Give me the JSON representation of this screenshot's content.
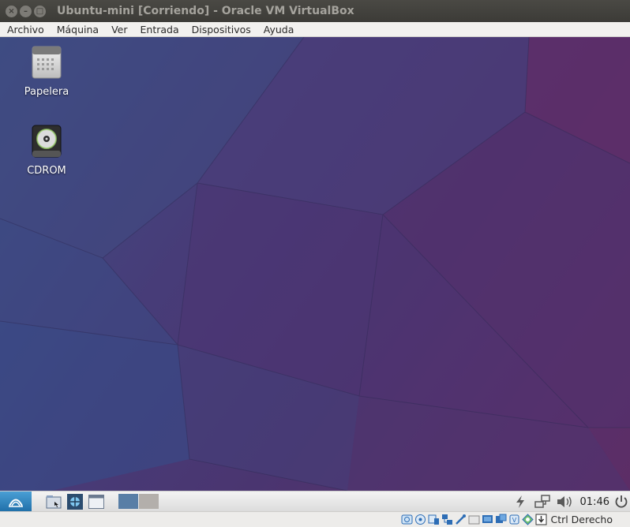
{
  "window": {
    "title": "Ubuntu-mini [Corriendo] - Oracle VM VirtualBox",
    "buttons": [
      "close",
      "minimize",
      "maximize"
    ]
  },
  "menubar": {
    "items": [
      "Archivo",
      "Máquina",
      "Ver",
      "Entrada",
      "Dispositivos",
      "Ayuda"
    ]
  },
  "desktop": {
    "icons": [
      {
        "label": "Papelera",
        "icon": "trash-icon"
      },
      {
        "label": "CDROM",
        "icon": "cdrom-icon"
      }
    ]
  },
  "panel": {
    "clock": "01:46",
    "launchers": [
      "file-manager-icon",
      "web-browser-icon",
      "terminal-icon"
    ],
    "tray": [
      "power-manager-icon",
      "network-icon",
      "volume-icon",
      "shutdown-icon"
    ]
  },
  "statusbar": {
    "host_key": "Ctrl Derecho",
    "icons": [
      "hard-disk-icon",
      "optical-drive-icon",
      "audio-icon",
      "network-adapter-icon",
      "usb-icon",
      "shared-folders-icon",
      "display-icon",
      "video-capture-icon",
      "cpu-icon",
      "mouse-integration-icon",
      "keyboard-capture-icon"
    ]
  },
  "colors": {
    "titlebar": "#3c3b37",
    "menubar": "#f2f1ef",
    "desktop_accent": "#473c78",
    "panel": "#dcdcdc"
  }
}
